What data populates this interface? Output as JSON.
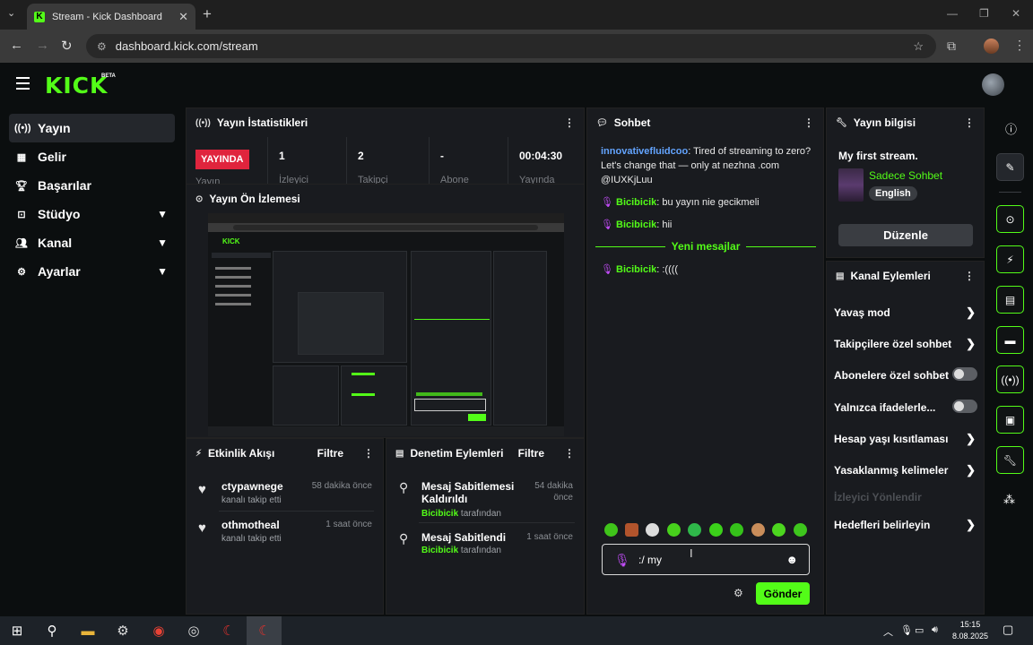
{
  "browser": {
    "tab_title": "Stream - Kick Dashboard",
    "url": "dashboard.kick.com/stream",
    "new_tab": "+",
    "close_tab": "✕"
  },
  "header": {
    "logo": "KICK",
    "beta": "BETA"
  },
  "sidebar": {
    "items": [
      {
        "label": "Yayın",
        "icon": "broadcast-icon"
      },
      {
        "label": "Gelir",
        "icon": "revenue-icon"
      },
      {
        "label": "Başarılar",
        "icon": "trophy-icon"
      },
      {
        "label": "Stüdyo",
        "icon": "studio-icon"
      },
      {
        "label": "Kanal",
        "icon": "channel-icon"
      },
      {
        "label": "Ayarlar",
        "icon": "settings-icon"
      }
    ]
  },
  "stats": {
    "title": "Yayın İstatistikleri",
    "live_badge": "YAYINDA",
    "live_sub": "Yayın",
    "cells": [
      {
        "value": "1",
        "label": "İzleyici"
      },
      {
        "value": "2",
        "label": "Takipçi"
      },
      {
        "value": "-",
        "label": "Abone"
      },
      {
        "value": "00:04:30",
        "label": "Yayında"
      }
    ]
  },
  "preview": {
    "title": "Yayın Ön İzlemesi"
  },
  "activity": {
    "title": "Etkinlik Akışı",
    "filter": "Filtre",
    "items": [
      {
        "name": "ctypawnege",
        "desc": "kanalı takip etti",
        "time": "58 dakika önce"
      },
      {
        "name": "othmotheal",
        "desc": "kanalı takip etti",
        "time": "1 saat önce"
      }
    ]
  },
  "moderation": {
    "title": "Denetim Eylemleri",
    "filter": "Filtre",
    "items": [
      {
        "title_line1": "Mesaj Sabitlemesi",
        "title_line2": "Kaldırıldı",
        "user": "Bicibicik",
        "by": "tarafından",
        "time_line1": "54 dakika",
        "time_line2": "önce"
      },
      {
        "title_line1": "Mesaj Sabitlendi",
        "title_line2": "",
        "user": "Bicibicik",
        "by": "tarafından",
        "time_line1": "1 saat önce",
        "time_line2": ""
      }
    ]
  },
  "chat": {
    "title": "Sohbet",
    "messages": [
      {
        "user": "innovativefluidcoo",
        "text": ": Tired of streaming to zero? Let's change that — only at nezhna .com @IUXKjLuu"
      },
      {
        "user": "Bicibicik",
        "text": ": bu yayın nie gecikmeli"
      },
      {
        "user": "Bicibicik",
        "text": ": hii"
      },
      {
        "user": "Bicibicik",
        "text": ": :(((("
      }
    ],
    "new_messages": "Yeni mesajlar",
    "input_value": ":/ my",
    "send": "Gönder"
  },
  "stream_info": {
    "title": "Yayın bilgisi",
    "stream_title": "My first stream.",
    "category": "Sadece Sohbet",
    "language": "English",
    "edit": "Düzenle"
  },
  "channel_actions": {
    "title": "Kanal Eylemleri",
    "items": [
      {
        "label": "Yavaş mod",
        "type": "arrow"
      },
      {
        "label": "Takipçilere özel sohbet",
        "type": "arrow"
      },
      {
        "label": "Abonelere özel sohbet",
        "type": "toggle"
      },
      {
        "label": "Yalnızca ifadelerle...",
        "type": "toggle"
      },
      {
        "label": "Hesap yaşı kısıtlaması",
        "type": "arrow"
      },
      {
        "label": "Yasaklanmış kelimeler",
        "type": "arrow"
      },
      {
        "label": "İzleyici Yönlendir",
        "type": "disabled"
      },
      {
        "label": "Hedefleri belirleyin",
        "type": "arrow"
      }
    ]
  },
  "taskbar": {
    "time": "15:15",
    "date": "8.08.2025"
  },
  "colors": {
    "accent": "#53fc18",
    "live": "#e0243d",
    "panel": "#191b1f",
    "bg": "#0b0e0f"
  }
}
